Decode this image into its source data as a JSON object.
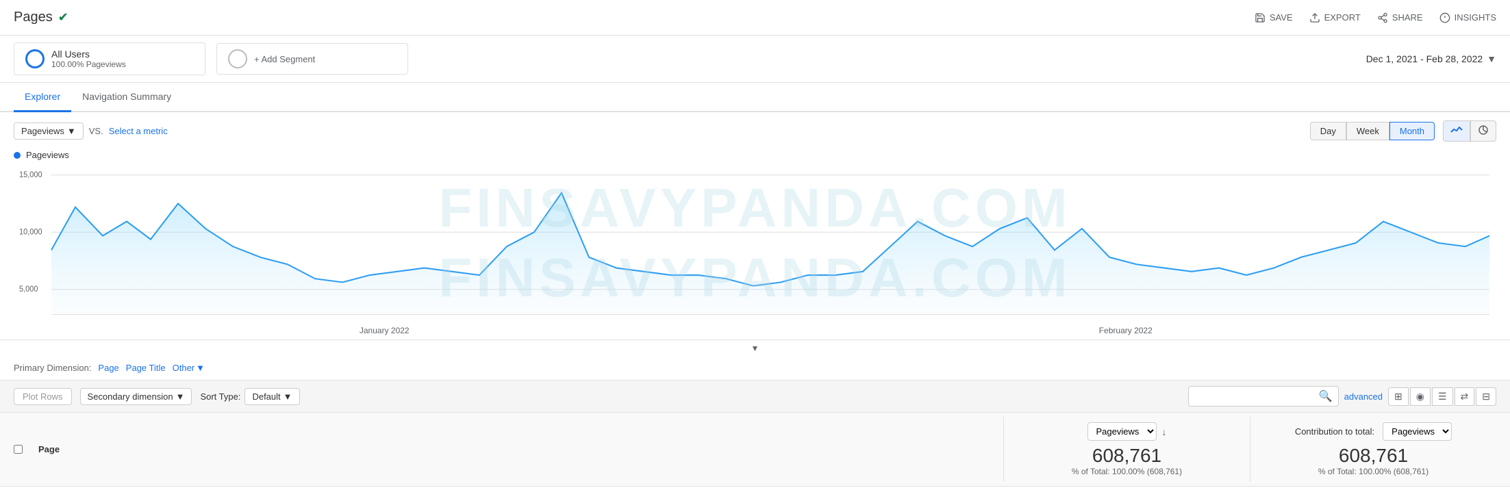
{
  "header": {
    "title": "Pages",
    "verified": true,
    "actions": [
      {
        "label": "SAVE",
        "icon": "save"
      },
      {
        "label": "EXPORT",
        "icon": "export"
      },
      {
        "label": "SHARE",
        "icon": "share"
      },
      {
        "label": "INSIGHTS",
        "icon": "insights"
      }
    ]
  },
  "segments": {
    "active": {
      "label": "All Users",
      "sublabel": "100.00% Pageviews"
    },
    "add_label": "+ Add Segment"
  },
  "date_range": "Dec 1, 2021 - Feb 28, 2022",
  "tabs": [
    {
      "label": "Explorer",
      "active": true
    },
    {
      "label": "Navigation Summary",
      "active": false
    }
  ],
  "chart": {
    "metric_dropdown": "Pageviews",
    "vs_label": "VS.",
    "select_metric": "Select a metric",
    "time_buttons": [
      {
        "label": "Day",
        "active": false
      },
      {
        "label": "Week",
        "active": false
      },
      {
        "label": "Month",
        "active": true
      }
    ],
    "chart_type_line": "line",
    "chart_type_pie": "pie",
    "y_labels": [
      "15,000",
      "10,000",
      "5,000"
    ],
    "date_labels": [
      "January 2022",
      "February 2022"
    ],
    "series_label": "Pageviews",
    "watermark_line1": "FINSAVYPANDA.COM",
    "watermark_line2": "FINSAVYPANDA.COM"
  },
  "primary_dimension": {
    "label": "Primary Dimension:",
    "options": [
      {
        "label": "Page",
        "active": true
      },
      {
        "label": "Page Title",
        "active": false
      },
      {
        "label": "Other",
        "active": false,
        "has_arrow": true
      }
    ]
  },
  "table_controls": {
    "plot_rows": "Plot Rows",
    "secondary_dimension": "Secondary dimension",
    "sort_type_label": "Sort Type:",
    "sort_default": "Default",
    "search_placeholder": "",
    "advanced_label": "advanced"
  },
  "table": {
    "col_page": "Page",
    "metrics": [
      {
        "group_label": "Pageviews",
        "show_dropdown": true,
        "dropdown_value": "Pageviews",
        "sort_icon": "down",
        "total_big": "608,761",
        "total_sub": "% of Total: 100.00% (608,761)"
      },
      {
        "group_label": "Contribution to total:",
        "show_contribution": true,
        "contribution_value": "Pageviews",
        "total_big": "608,761",
        "total_sub": "% of Total: 100.00% (608,761)"
      }
    ]
  }
}
